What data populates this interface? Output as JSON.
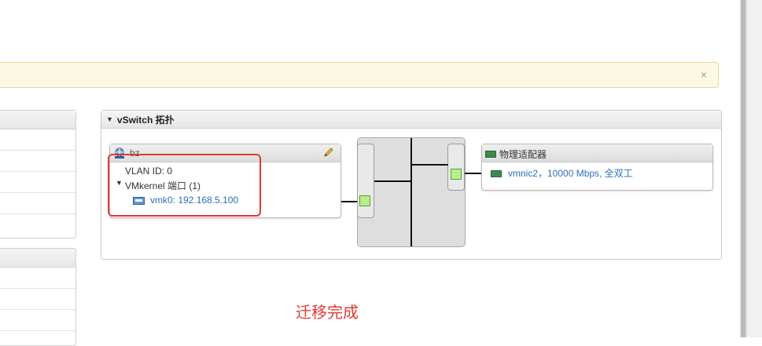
{
  "banner": {
    "close_glyph": "×"
  },
  "vswitch_panel": {
    "title": "vSwitch 拓扑"
  },
  "port_group": {
    "name": "bz",
    "vlan": "VLAN ID: 0",
    "vmkernel_ports": "VMkernel 端口 (1)",
    "vmk": "vmk0: 192.168.5.100"
  },
  "physical_adapters": {
    "title": "物理适配器",
    "nic": "vmnic2，10000 Mbps, 全双工"
  },
  "status": {
    "text": "迁移完成"
  },
  "colors": {
    "highlight": "#e53935",
    "link": "#2d6fb8",
    "port_fill": "#b6f08a",
    "banner": "#fdf8e4"
  }
}
